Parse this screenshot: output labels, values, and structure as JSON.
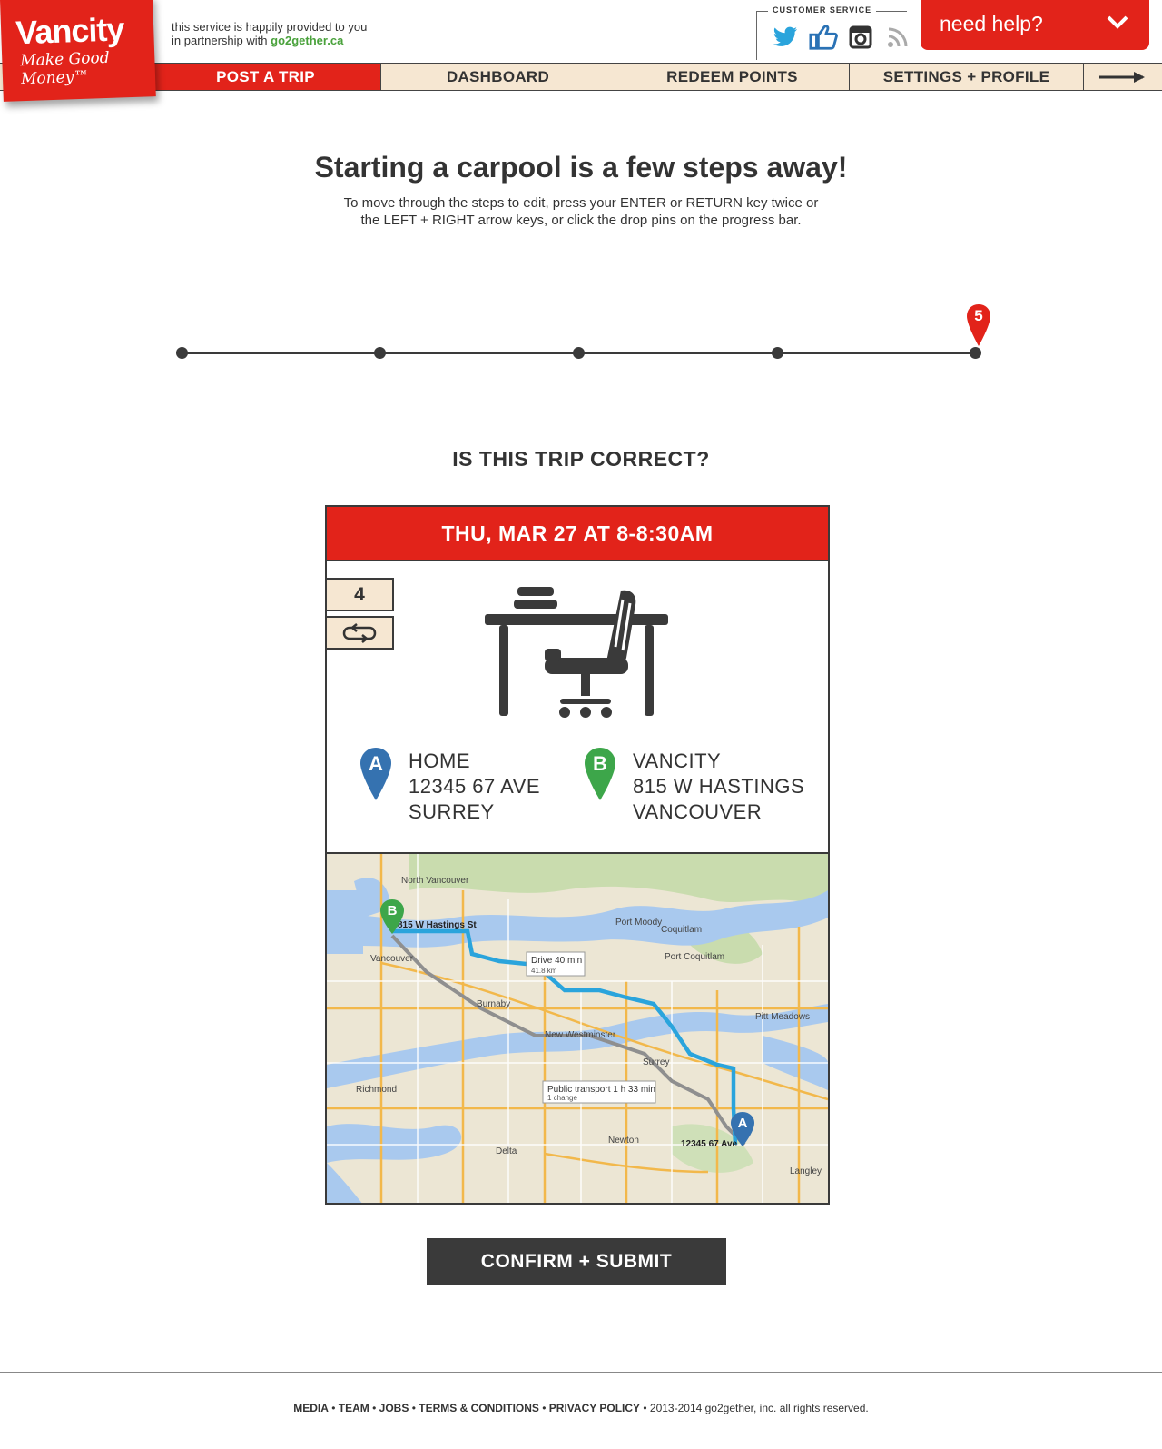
{
  "brand": {
    "name": "Vancity",
    "tagline": "Make Good Money™"
  },
  "partner": {
    "line1": "this service is happily provided to you",
    "line2_prefix": "in partnership with",
    "link": "go2gether.ca"
  },
  "customer_service": {
    "label": "CUSTOMER SERVICE",
    "icons": [
      "twitter-icon",
      "thumbs-up-icon",
      "instagram-icon",
      "rss-icon"
    ]
  },
  "help": {
    "label": "need help?"
  },
  "nav": {
    "items": [
      {
        "label": "POST A TRIP",
        "active": true
      },
      {
        "label": "DASHBOARD",
        "active": false
      },
      {
        "label": "REDEEM POINTS",
        "active": false
      },
      {
        "label": "SETTINGS + PROFILE",
        "active": false
      }
    ]
  },
  "main": {
    "headline": "Starting a carpool is a few steps away!",
    "subtext_line1": "To move through the steps to edit, press your ENTER or RETURN key twice or",
    "subtext_line2": "the LEFT + RIGHT arrow keys, or click the drop pins on the progress bar.",
    "progress": {
      "total_steps": 5,
      "current_step": "5"
    },
    "question": "IS THIS TRIP CORRECT?"
  },
  "trip": {
    "datetime": "THU, MAR 27 AT 8-8:30AM",
    "seats": "4",
    "origin": {
      "pin_letter": "A",
      "name": "HOME",
      "address": "12345 67 AVE",
      "city": "SURREY"
    },
    "destination": {
      "pin_letter": "B",
      "name": "VANCITY",
      "address": "815 W HASTINGS",
      "city": "VANCOUVER"
    },
    "map": {
      "drive_label": "Drive 40 min",
      "drive_distance": "41.8 km",
      "transit_label": "Public transport 1 h 33 min",
      "transit_changes": "1 change",
      "dest_label": "815 W Hastings St",
      "origin_label": "12345 67 Ave",
      "places": [
        "North Vancouver",
        "Vancouver",
        "Burnaby",
        "Port Moody",
        "Coquitlam",
        "Port Coquitlam",
        "New Westminster",
        "Surrey",
        "Richmond",
        "Delta",
        "Newton",
        "Langley",
        "Pitt Meadows"
      ]
    }
  },
  "actions": {
    "confirm": "CONFIRM + SUBMIT"
  },
  "footer": {
    "links": [
      "MEDIA",
      "TEAM",
      "JOBS",
      "TERMS & CONDITIONS",
      "PRIVACY POLICY"
    ],
    "copyright": "2013-2014 go2gether, inc. all rights reserved."
  },
  "colors": {
    "brand_red": "#e2231a",
    "nav_bg": "#f6e7d2",
    "dark": "#3a3a3a",
    "pin_blue": "#3572b0",
    "pin_green": "#3da64a",
    "route_blue": "#2aa4dc"
  }
}
